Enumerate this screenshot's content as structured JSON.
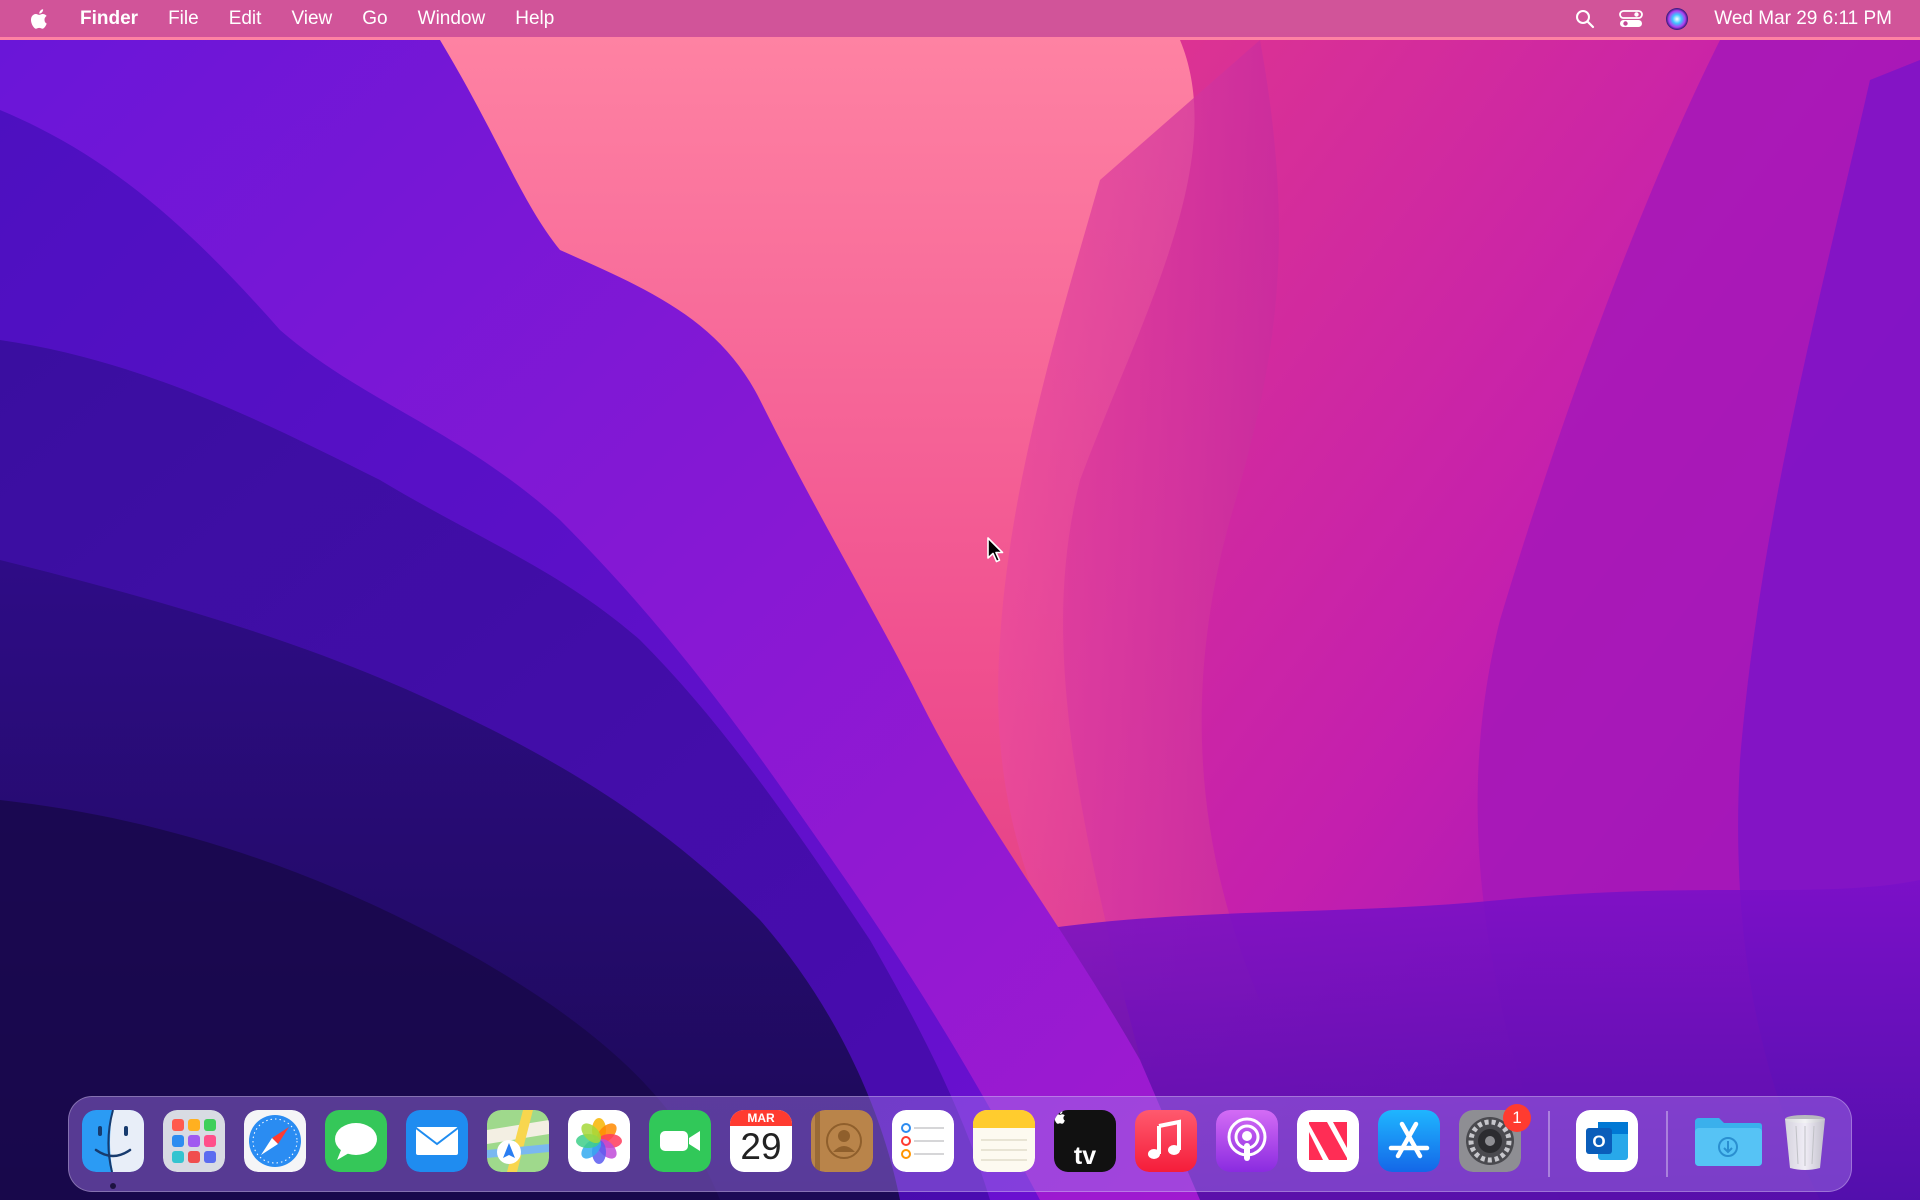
{
  "menubar": {
    "apple_icon": "apple-logo-icon",
    "app_name": "Finder",
    "menus": [
      "File",
      "Edit",
      "View",
      "Go",
      "Window",
      "Help"
    ],
    "status_icons": [
      "search-icon",
      "control-center-icon",
      "siri-icon"
    ],
    "clock": "Wed Mar 29  6:11 PM"
  },
  "dock": {
    "apps": [
      {
        "name": "Finder",
        "icon": "finder-icon",
        "running": true
      },
      {
        "name": "Launchpad",
        "icon": "launchpad-icon"
      },
      {
        "name": "Safari",
        "icon": "safari-icon"
      },
      {
        "name": "Messages",
        "icon": "messages-icon"
      },
      {
        "name": "Mail",
        "icon": "mail-icon"
      },
      {
        "name": "Maps",
        "icon": "maps-icon"
      },
      {
        "name": "Photos",
        "icon": "photos-icon"
      },
      {
        "name": "FaceTime",
        "icon": "facetime-icon"
      },
      {
        "name": "Calendar",
        "icon": "calendar-icon",
        "month": "MAR",
        "day": "29"
      },
      {
        "name": "Contacts",
        "icon": "contacts-icon"
      },
      {
        "name": "Reminders",
        "icon": "reminders-icon"
      },
      {
        "name": "Notes",
        "icon": "notes-icon"
      },
      {
        "name": "TV",
        "icon": "apple-tv-icon",
        "label": "tv"
      },
      {
        "name": "Music",
        "icon": "music-icon"
      },
      {
        "name": "Podcasts",
        "icon": "podcasts-icon"
      },
      {
        "name": "News",
        "icon": "news-icon"
      },
      {
        "name": "App Store",
        "icon": "app-store-icon"
      },
      {
        "name": "System Settings",
        "icon": "system-settings-icon",
        "badge": "1"
      }
    ],
    "recent_apps": [
      {
        "name": "Microsoft Outlook",
        "icon": "outlook-icon",
        "label": "O"
      }
    ],
    "stacks": [
      {
        "name": "Downloads",
        "icon": "downloads-folder-icon"
      },
      {
        "name": "Trash",
        "icon": "trash-icon"
      }
    ]
  },
  "colors": {
    "menubar": "#c44696",
    "wallpaper_pink": "#ff7fa3",
    "wallpaper_purple": "#5a12c8",
    "wallpaper_dark": "#1f0d55",
    "badge": "#ff3b30"
  }
}
